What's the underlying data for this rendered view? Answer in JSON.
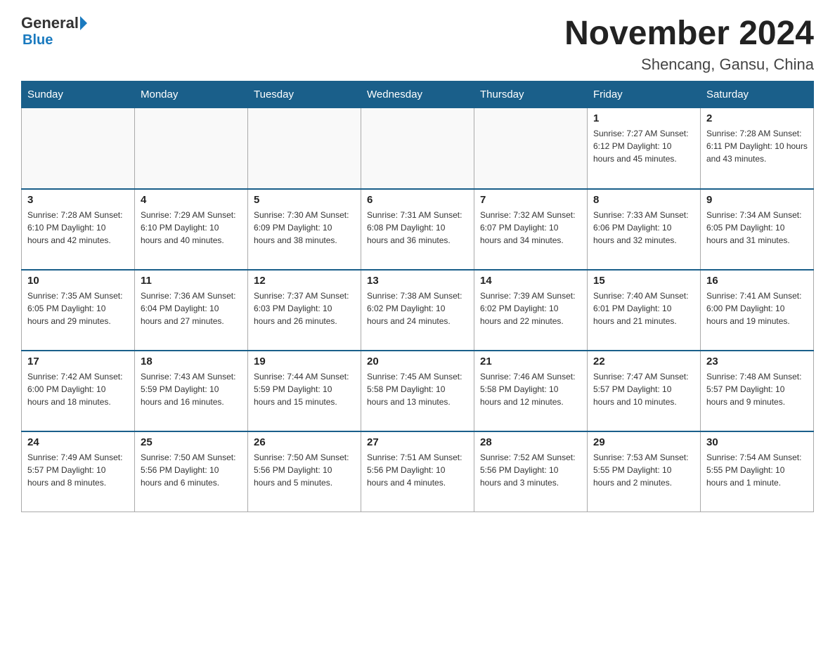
{
  "header": {
    "logo_general": "General",
    "logo_blue": "Blue",
    "month_title": "November 2024",
    "location": "Shencang, Gansu, China"
  },
  "weekdays": [
    "Sunday",
    "Monday",
    "Tuesday",
    "Wednesday",
    "Thursday",
    "Friday",
    "Saturday"
  ],
  "weeks": [
    [
      {
        "day": "",
        "info": ""
      },
      {
        "day": "",
        "info": ""
      },
      {
        "day": "",
        "info": ""
      },
      {
        "day": "",
        "info": ""
      },
      {
        "day": "",
        "info": ""
      },
      {
        "day": "1",
        "info": "Sunrise: 7:27 AM\nSunset: 6:12 PM\nDaylight: 10 hours and 45 minutes."
      },
      {
        "day": "2",
        "info": "Sunrise: 7:28 AM\nSunset: 6:11 PM\nDaylight: 10 hours and 43 minutes."
      }
    ],
    [
      {
        "day": "3",
        "info": "Sunrise: 7:28 AM\nSunset: 6:10 PM\nDaylight: 10 hours and 42 minutes."
      },
      {
        "day": "4",
        "info": "Sunrise: 7:29 AM\nSunset: 6:10 PM\nDaylight: 10 hours and 40 minutes."
      },
      {
        "day": "5",
        "info": "Sunrise: 7:30 AM\nSunset: 6:09 PM\nDaylight: 10 hours and 38 minutes."
      },
      {
        "day": "6",
        "info": "Sunrise: 7:31 AM\nSunset: 6:08 PM\nDaylight: 10 hours and 36 minutes."
      },
      {
        "day": "7",
        "info": "Sunrise: 7:32 AM\nSunset: 6:07 PM\nDaylight: 10 hours and 34 minutes."
      },
      {
        "day": "8",
        "info": "Sunrise: 7:33 AM\nSunset: 6:06 PM\nDaylight: 10 hours and 32 minutes."
      },
      {
        "day": "9",
        "info": "Sunrise: 7:34 AM\nSunset: 6:05 PM\nDaylight: 10 hours and 31 minutes."
      }
    ],
    [
      {
        "day": "10",
        "info": "Sunrise: 7:35 AM\nSunset: 6:05 PM\nDaylight: 10 hours and 29 minutes."
      },
      {
        "day": "11",
        "info": "Sunrise: 7:36 AM\nSunset: 6:04 PM\nDaylight: 10 hours and 27 minutes."
      },
      {
        "day": "12",
        "info": "Sunrise: 7:37 AM\nSunset: 6:03 PM\nDaylight: 10 hours and 26 minutes."
      },
      {
        "day": "13",
        "info": "Sunrise: 7:38 AM\nSunset: 6:02 PM\nDaylight: 10 hours and 24 minutes."
      },
      {
        "day": "14",
        "info": "Sunrise: 7:39 AM\nSunset: 6:02 PM\nDaylight: 10 hours and 22 minutes."
      },
      {
        "day": "15",
        "info": "Sunrise: 7:40 AM\nSunset: 6:01 PM\nDaylight: 10 hours and 21 minutes."
      },
      {
        "day": "16",
        "info": "Sunrise: 7:41 AM\nSunset: 6:00 PM\nDaylight: 10 hours and 19 minutes."
      }
    ],
    [
      {
        "day": "17",
        "info": "Sunrise: 7:42 AM\nSunset: 6:00 PM\nDaylight: 10 hours and 18 minutes."
      },
      {
        "day": "18",
        "info": "Sunrise: 7:43 AM\nSunset: 5:59 PM\nDaylight: 10 hours and 16 minutes."
      },
      {
        "day": "19",
        "info": "Sunrise: 7:44 AM\nSunset: 5:59 PM\nDaylight: 10 hours and 15 minutes."
      },
      {
        "day": "20",
        "info": "Sunrise: 7:45 AM\nSunset: 5:58 PM\nDaylight: 10 hours and 13 minutes."
      },
      {
        "day": "21",
        "info": "Sunrise: 7:46 AM\nSunset: 5:58 PM\nDaylight: 10 hours and 12 minutes."
      },
      {
        "day": "22",
        "info": "Sunrise: 7:47 AM\nSunset: 5:57 PM\nDaylight: 10 hours and 10 minutes."
      },
      {
        "day": "23",
        "info": "Sunrise: 7:48 AM\nSunset: 5:57 PM\nDaylight: 10 hours and 9 minutes."
      }
    ],
    [
      {
        "day": "24",
        "info": "Sunrise: 7:49 AM\nSunset: 5:57 PM\nDaylight: 10 hours and 8 minutes."
      },
      {
        "day": "25",
        "info": "Sunrise: 7:50 AM\nSunset: 5:56 PM\nDaylight: 10 hours and 6 minutes."
      },
      {
        "day": "26",
        "info": "Sunrise: 7:50 AM\nSunset: 5:56 PM\nDaylight: 10 hours and 5 minutes."
      },
      {
        "day": "27",
        "info": "Sunrise: 7:51 AM\nSunset: 5:56 PM\nDaylight: 10 hours and 4 minutes."
      },
      {
        "day": "28",
        "info": "Sunrise: 7:52 AM\nSunset: 5:56 PM\nDaylight: 10 hours and 3 minutes."
      },
      {
        "day": "29",
        "info": "Sunrise: 7:53 AM\nSunset: 5:55 PM\nDaylight: 10 hours and 2 minutes."
      },
      {
        "day": "30",
        "info": "Sunrise: 7:54 AM\nSunset: 5:55 PM\nDaylight: 10 hours and 1 minute."
      }
    ]
  ]
}
